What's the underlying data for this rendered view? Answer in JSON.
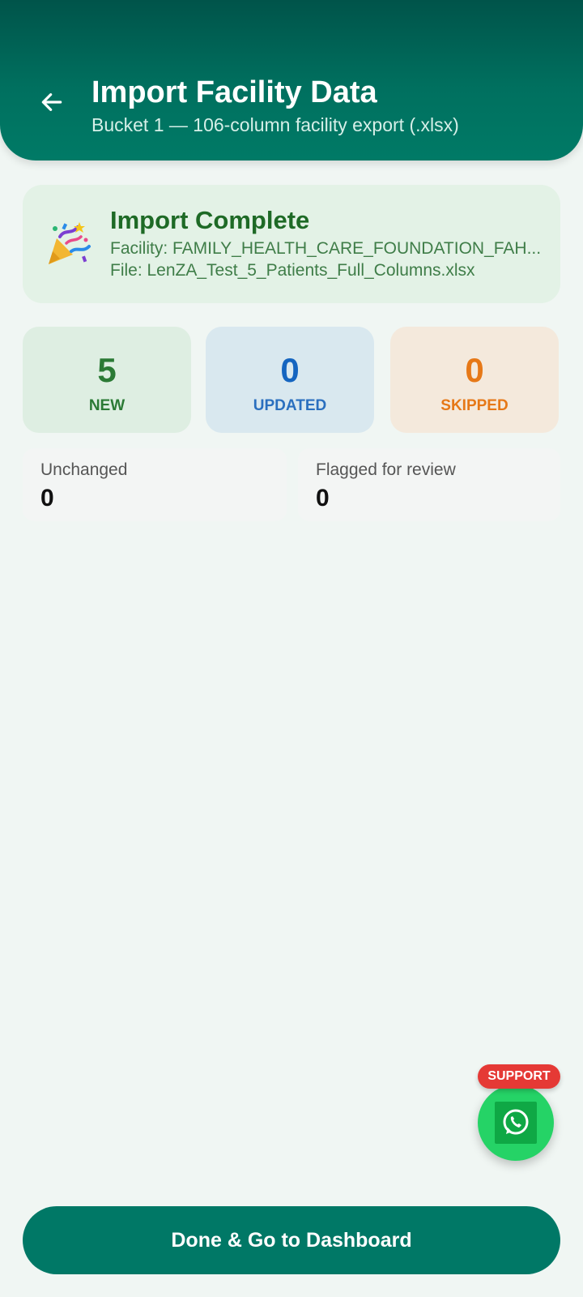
{
  "header": {
    "title": "Import Facility Data",
    "subtitle": "Bucket 1 — 106-column facility export (.xlsx)"
  },
  "result": {
    "icon": "party-popper-icon",
    "title": "Import Complete",
    "facility_line": "Facility: FAMILY_HEALTH_CARE_FOUNDATION_FAH...",
    "file_line": "File: LenZA_Test_5_Patients_Full_Columns.xlsx"
  },
  "stats": {
    "new": {
      "value": "5",
      "label": "NEW",
      "color": "#2b7a35"
    },
    "updated": {
      "value": "0",
      "label": "UPDATED",
      "color": "#1565c0"
    },
    "skipped": {
      "value": "0",
      "label": "SKIPPED",
      "color": "#e67817"
    }
  },
  "details": {
    "unchanged": {
      "label": "Unchanged",
      "value": "0"
    },
    "flagged": {
      "label": "Flagged for review",
      "value": "0"
    }
  },
  "support": {
    "badge": "SUPPORT",
    "icon": "whatsapp-icon"
  },
  "footer": {
    "done_label": "Done & Go to Dashboard"
  },
  "colors": {
    "header": "#00705f",
    "primary_button": "#007866",
    "background": "#f0f6f3",
    "whatsapp": "#25d366",
    "support_badge": "#e53935"
  }
}
